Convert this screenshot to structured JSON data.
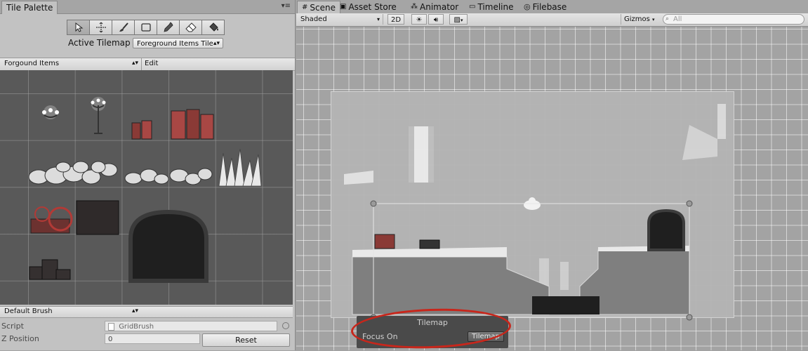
{
  "left_panel": {
    "tab_title": "Tile Palette",
    "active_tilemap_label": "Active Tilemap",
    "active_tilemap_value": "Foreground Items Tile",
    "palette_dropdown": "Forgound Items",
    "edit_label": "Edit",
    "brush_dropdown": "Default Brush",
    "script_label": "Script",
    "script_value": "GridBrush",
    "zpos_label": "Z Position",
    "zpos_value": "0",
    "reset_label": "Reset"
  },
  "scene": {
    "tabs": [
      "Scene",
      "Asset Store",
      "Animator",
      "Timeline",
      "Filebase"
    ],
    "shading": "Shaded",
    "mode_2d": "2D",
    "gizmos": "Gizmos",
    "search_placeholder": "All"
  },
  "tilemap_overlay": {
    "title": "Tilemap",
    "focus_label": "Focus On",
    "focus_value": "Tilemap"
  },
  "icons": [
    "select-icon",
    "move-icon",
    "paint-brush-icon",
    "box-fill-icon",
    "eyedropper-icon",
    "eraser-icon",
    "fill-bucket-icon",
    "sun-icon",
    "speaker-icon",
    "image-icon",
    "search-icon"
  ]
}
